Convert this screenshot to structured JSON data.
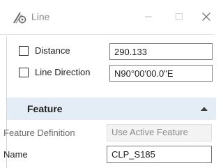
{
  "window": {
    "title": "Line",
    "icon": "line-tool-icon",
    "minimize_icon": "minimize-icon",
    "maximize_icon": "maximize-icon",
    "close_icon": "close-icon"
  },
  "params": [
    {
      "label": "Distance",
      "value": "290.133",
      "checked": false
    },
    {
      "label": "Line Direction",
      "value": "N90°00'00.0\"E",
      "checked": false
    }
  ],
  "feature": {
    "title": "Feature",
    "collapse_icon": "chevron-up-icon",
    "definition_label": "Feature Definition",
    "definition_value": "Use Active Feature",
    "name_label": "Name",
    "name_value": "CLP_S185"
  },
  "colors": {
    "section_header_bg": "#e4edf6",
    "title_text": "#8a8a8a"
  }
}
